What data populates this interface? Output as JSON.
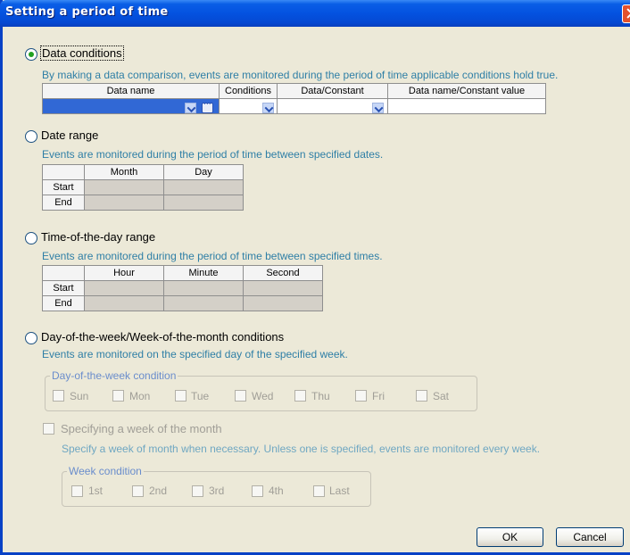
{
  "window": {
    "title": "Setting a period of time"
  },
  "data_conditions": {
    "label": "Data conditions",
    "selected": true,
    "description": "By making a data comparison, events are monitored during the period of time applicable conditions hold true.",
    "columns": [
      "Data name",
      "Conditions",
      "Data/Constant",
      "Data name/Constant value"
    ],
    "row": {
      "data_name": "",
      "conditions": "",
      "data_constant": "",
      "value": ""
    }
  },
  "date_range": {
    "label": "Date range",
    "selected": false,
    "description": "Events are monitored during the period of time between specified dates.",
    "columns": [
      "Month",
      "Day"
    ],
    "rows": [
      "Start",
      "End"
    ]
  },
  "time_range": {
    "label": "Time-of-the-day range",
    "selected": false,
    "description": "Events are monitored during the period of time between specified times.",
    "columns": [
      "Hour",
      "Minute",
      "Second"
    ],
    "rows": [
      "Start",
      "End"
    ]
  },
  "week_conditions": {
    "label": "Day-of-the-week/Week-of-the-month conditions",
    "selected": false,
    "description": "Events are monitored on the specified day of the specified week.",
    "day_group": {
      "legend": "Day-of-the-week condition",
      "days": [
        "Sun",
        "Mon",
        "Tue",
        "Wed",
        "Thu",
        "Fri",
        "Sat"
      ]
    },
    "specify_week": {
      "label": "Specifying a week of the month",
      "description": "Specify a week of month when necessary. Unless one is specified, events are monitored every week."
    },
    "week_group": {
      "legend": "Week condition",
      "weeks": [
        "1st",
        "2nd",
        "3rd",
        "4th",
        "Last"
      ]
    }
  },
  "buttons": {
    "ok": "OK",
    "cancel": "Cancel"
  }
}
